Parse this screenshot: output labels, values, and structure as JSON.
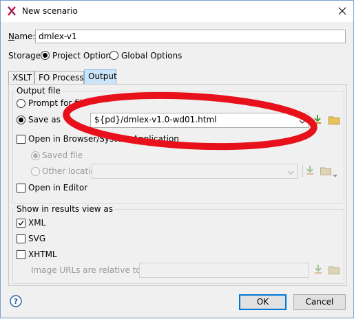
{
  "window": {
    "title": "New scenario"
  },
  "name": {
    "label": "Name:",
    "value": "dmlex-v1"
  },
  "storage": {
    "label": "Storage:",
    "options": [
      {
        "label": "Project Options",
        "selected": true
      },
      {
        "label": "Global Options",
        "selected": false
      }
    ]
  },
  "tabs": [
    {
      "label": "XSLT",
      "active": false
    },
    {
      "label": "FO Processor",
      "active": false
    },
    {
      "label": "Output",
      "active": true
    }
  ],
  "output_file": {
    "group_label": "Output file",
    "prompt_label": "Prompt for file",
    "save_as_label": "Save as",
    "save_as_value": "${pd}/dmlex-v1.0-wd01.html",
    "open_browser_label": "Open in Browser/System Application",
    "saved_file_label": "Saved file",
    "other_location_label": "Other location",
    "open_editor_label": "Open in Editor"
  },
  "results_view": {
    "group_label": "Show in results view as",
    "xml_label": "XML",
    "xml_checked": true,
    "svg_label": "SVG",
    "svg_checked": false,
    "xhtml_label": "XHTML",
    "xhtml_checked": false,
    "image_urls_label": "Image URLs are relative to:"
  },
  "buttons": {
    "ok": "OK",
    "cancel": "Cancel"
  },
  "colors": {
    "annotation": "#e8101a",
    "accent": "#0078d7",
    "folder": "#e8c35a",
    "insert_arrow": "#4d9a3a"
  }
}
